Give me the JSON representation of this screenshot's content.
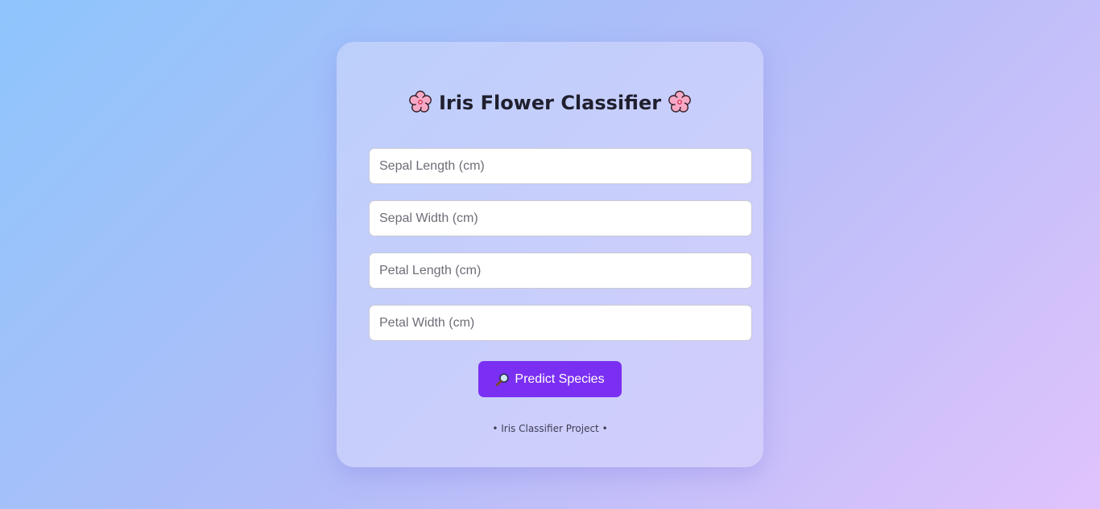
{
  "header": {
    "title": "Iris Flower Classifier",
    "icon_left": "cherry-blossom-icon",
    "icon_right": "cherry-blossom-icon"
  },
  "form": {
    "fields": [
      {
        "placeholder": "Sepal Length (cm)",
        "value": ""
      },
      {
        "placeholder": "Sepal Width (cm)",
        "value": ""
      },
      {
        "placeholder": "Petal Length (cm)",
        "value": ""
      },
      {
        "placeholder": "Petal Width (cm)",
        "value": ""
      }
    ],
    "submit_label": "Predict Species",
    "submit_icon": "magnifier-icon"
  },
  "footer": {
    "text": "• Iris Classifier Project •"
  },
  "colors": {
    "accent": "#7b2ff2",
    "card": "#c8cefb",
    "background_start": "#8ec5fc",
    "background_end": "#e0c3fc"
  }
}
